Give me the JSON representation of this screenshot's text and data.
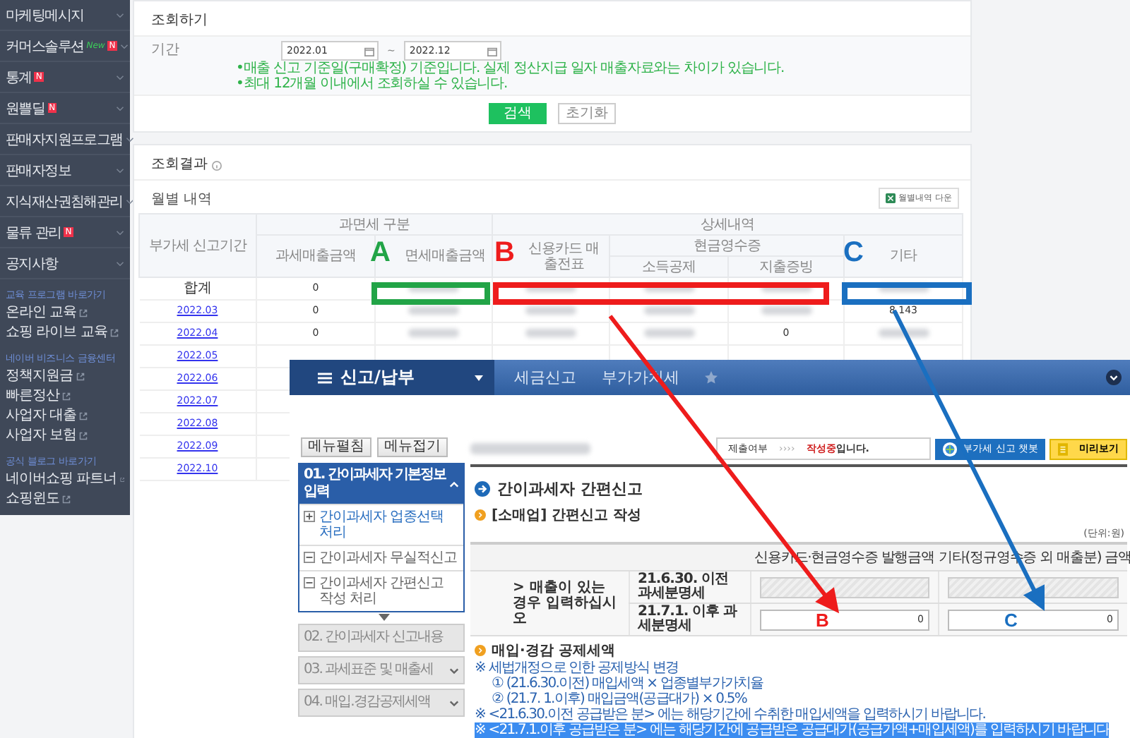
{
  "sidebar": {
    "items": [
      {
        "label": "마케팅메시지"
      },
      {
        "label": "커머스솔루션",
        "badge": "N",
        "tag": "New"
      },
      {
        "label": "통계",
        "badge": "N"
      },
      {
        "label": "원쁠딜",
        "badge": "N"
      },
      {
        "label": "판매자지원프로그램"
      },
      {
        "label": "판매자정보"
      },
      {
        "label": "지식재산권침해관리"
      },
      {
        "label": "물류 관리",
        "badge": "N"
      },
      {
        "label": "공지사항"
      }
    ],
    "sections": [
      {
        "title": "교육 프로그램 바로가기",
        "links": [
          "온라인 교육",
          "쇼핑 라이브 교육"
        ]
      },
      {
        "title": "네이버 비즈니스 금융센터",
        "links": [
          "정책지원금",
          "빠른정산",
          "사업자 대출",
          "사업자 보험"
        ]
      },
      {
        "title": "공식 블로그 바로가기",
        "links": [
          "네이버쇼핑 파트너",
          "쇼핑윈도"
        ]
      }
    ]
  },
  "search": {
    "title": "조회하기",
    "period_label": "기간",
    "from": "2022.01",
    "separator": "~",
    "to": "2022.12",
    "notes": [
      "•매출 신고 기준일(구매확정) 기준입니다. 실제 정산지급 일자 매출자료와는 차이가 있습니다.",
      "•최대 12개월 이내에서 조회하실 수 있습니다."
    ],
    "buttons": [
      {
        "label": "검색",
        "primary": true
      },
      {
        "label": "초기화",
        "primary": false
      }
    ]
  },
  "results": {
    "title": "조회결과",
    "subtitle": "월별 내역",
    "download": "월별내역 다운",
    "columns": {
      "period": "부가세 신고기간",
      "group_tax": "과면세 구분",
      "taxable": "과세매출금액",
      "exempt": "면세매출금액",
      "group_detail": "상세내역",
      "card": "신용카드 매출전표",
      "cash_group": "현금영수증",
      "cash_deduct": "소득공제",
      "cash_proof": "지출증빙",
      "other": "기타"
    },
    "rows": [
      {
        "period": "합계",
        "link": false,
        "cells": [
          {
            "kind": "text",
            "text": "0"
          },
          {
            "kind": "blurred"
          },
          {
            "kind": "blurred"
          },
          {
            "kind": "blurred"
          },
          {
            "kind": "blurred"
          },
          {
            "kind": "blurred"
          }
        ]
      },
      {
        "period": "2022.03",
        "link": true,
        "cells": [
          {
            "kind": "text",
            "text": "0"
          },
          {
            "kind": "blurred"
          },
          {
            "kind": "blurred"
          },
          {
            "kind": "blurred"
          },
          {
            "kind": "blurred"
          },
          {
            "kind": "text",
            "text": "8,143"
          }
        ]
      },
      {
        "period": "2022.04",
        "link": true,
        "cells": [
          {
            "kind": "text",
            "text": "0"
          },
          {
            "kind": "blurred"
          },
          {
            "kind": "blurred"
          },
          {
            "kind": "blurred"
          },
          {
            "kind": "text",
            "text": "0"
          },
          {
            "kind": "blurred"
          }
        ]
      },
      {
        "period": "2022.05",
        "link": true,
        "cells": []
      },
      {
        "period": "2022.06",
        "link": true,
        "cells": []
      },
      {
        "period": "2022.07",
        "link": true,
        "cells": []
      },
      {
        "period": "2022.08",
        "link": true,
        "cells": []
      },
      {
        "period": "2022.09",
        "link": true,
        "cells": []
      },
      {
        "period": "2022.10",
        "link": true,
        "cells": []
      }
    ]
  },
  "overlay": {
    "nav": {
      "menu": "신고/납부",
      "crumbs": [
        "세금신고",
        "부가가치세"
      ]
    },
    "menu_buttons": [
      "메뉴펼침",
      "메뉴접기"
    ],
    "steps": [
      {
        "label": "01. 간이과세자 기본정보 입력",
        "expanded": true,
        "chevron": true,
        "children": [
          {
            "label": "간이과세자 업종선택 처리",
            "expanded": false,
            "selected": true
          },
          {
            "label": "간이과세자 무실적신고",
            "expanded": true,
            "selected": false
          },
          {
            "label": "간이과세자 간편신고 작성 처리",
            "expanded": true,
            "selected": false
          }
        ]
      },
      {
        "label": "02. 간이과세자 신고내용",
        "expanded": false,
        "chevron": false
      },
      {
        "label": "03. 과세표준 및 매출세",
        "expanded": false,
        "chevron": true
      },
      {
        "label": "04. 매입.경감공제세액",
        "expanded": false,
        "chevron": true
      }
    ],
    "status": {
      "label": "제출여부",
      "arrows": "››››",
      "state": "작성중",
      "suffix": "입니다."
    },
    "chatbot": "부가세 신고 챗봇",
    "preview": "미리보기",
    "heading": "간이과세자 간편신고",
    "subheading": "[소매업] 간편신고 작성",
    "unit": "(단위:원)",
    "columns": [
      "신용카드·현금영수증 발행금액",
      "기타(정규영수증 외 매출분) 금액"
    ],
    "row_label": "> 매출이 있는 경우 입력하십시오",
    "rows": [
      {
        "label": "21.6.30. 이전 과세분명세",
        "inputs": [
          {
            "disabled": true
          },
          {
            "disabled": true
          }
        ]
      },
      {
        "label": "21.7.1. 이후 과세분명세",
        "inputs": [
          {
            "disabled": false,
            "value": "0"
          },
          {
            "disabled": false,
            "value": "0"
          }
        ]
      }
    ],
    "section": "매입·경감 공제세액",
    "notes": [
      {
        "kind": "note",
        "text": "※ 세법개정으로 인한 공제방식 변경"
      },
      {
        "kind": "item",
        "text": "① (21.6.30.이전) 매입세액 × 업종별부가가치율"
      },
      {
        "kind": "item",
        "text": "② (21.7. 1.이후) 매입금액(공급대가) × 0.5%"
      },
      {
        "kind": "note",
        "text": "※ <21.6.30.이전 공급받은 분> 에는 해당기간에 수취한 매입세액을 입력하시기 바랍니다."
      },
      {
        "kind": "highlight",
        "text": "※ <21.7.1.이후 공급받은 분> 에는 해당기간에 공급받은 공급대가(공급가액+매입세액)를 입력하시기 바랍니다"
      }
    ]
  },
  "annotations": [
    {
      "label": "A",
      "color": "#22a447",
      "arrow": false
    },
    {
      "label": "B",
      "color": "#ee1c1c",
      "arrow": true,
      "target_label": "B"
    },
    {
      "label": "C",
      "color": "#1a6fc0",
      "arrow": true,
      "target_label": "C"
    }
  ]
}
